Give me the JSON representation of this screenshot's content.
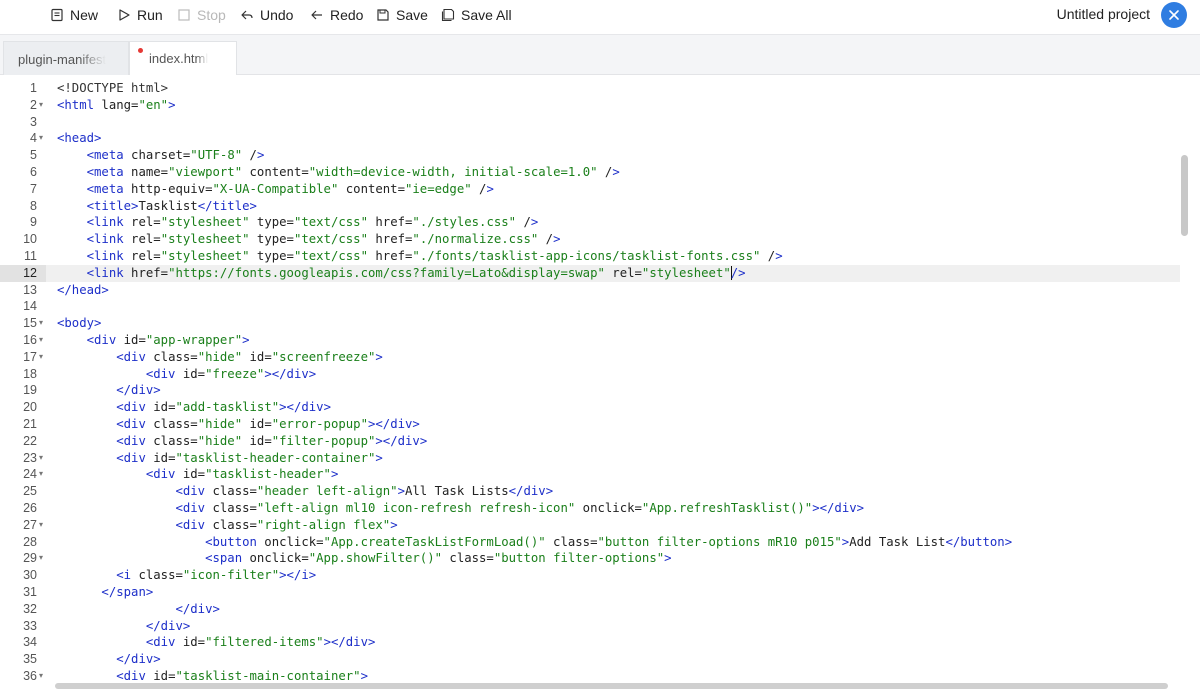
{
  "toolbar": {
    "new_label": "New",
    "run_label": "Run",
    "stop_label": "Stop",
    "undo_label": "Undo",
    "redo_label": "Redo",
    "save_label": "Save",
    "save_all_label": "Save All",
    "project_title": "Untitled project"
  },
  "tabs": [
    {
      "label": "plugin-manifest",
      "active": false,
      "modified": false
    },
    {
      "label": "index.html",
      "active": true,
      "modified": true
    }
  ],
  "editor": {
    "current_line": 12,
    "lines": [
      {
        "n": "1",
        "fold": false,
        "text": "<!DOCTYPE html>"
      },
      {
        "n": "2",
        "fold": true,
        "text": "<html lang=\"en\">"
      },
      {
        "n": "3",
        "fold": false,
        "text": ""
      },
      {
        "n": "4",
        "fold": true,
        "text": "<head>"
      },
      {
        "n": "5",
        "fold": false,
        "text": "    <meta charset=\"UTF-8\" />"
      },
      {
        "n": "6",
        "fold": false,
        "text": "    <meta name=\"viewport\" content=\"width=device-width, initial-scale=1.0\" />"
      },
      {
        "n": "7",
        "fold": false,
        "text": "    <meta http-equiv=\"X-UA-Compatible\" content=\"ie=edge\" />"
      },
      {
        "n": "8",
        "fold": false,
        "text": "    <title>Tasklist</title>"
      },
      {
        "n": "9",
        "fold": false,
        "text": "    <link rel=\"stylesheet\" type=\"text/css\" href=\"./styles.css\" />"
      },
      {
        "n": "10",
        "fold": false,
        "text": "    <link rel=\"stylesheet\" type=\"text/css\" href=\"./normalize.css\" />"
      },
      {
        "n": "11",
        "fold": false,
        "text": "    <link rel=\"stylesheet\" type=\"text/css\" href=\"./fonts/tasklist-app-icons/tasklist-fonts.css\" />"
      },
      {
        "n": "12",
        "fold": false,
        "text": "    <link href=\"https://fonts.googleapis.com/css?family=Lato&display=swap\" rel=\"stylesheet\"/>"
      },
      {
        "n": "13",
        "fold": false,
        "text": "</head>"
      },
      {
        "n": "14",
        "fold": false,
        "text": ""
      },
      {
        "n": "15",
        "fold": true,
        "text": "<body>"
      },
      {
        "n": "16",
        "fold": true,
        "text": "    <div id=\"app-wrapper\">"
      },
      {
        "n": "17",
        "fold": true,
        "text": "        <div class=\"hide\" id=\"screenfreeze\">"
      },
      {
        "n": "18",
        "fold": false,
        "text": "            <div id=\"freeze\"></div>"
      },
      {
        "n": "19",
        "fold": false,
        "text": "        </div>"
      },
      {
        "n": "20",
        "fold": false,
        "text": "        <div id=\"add-tasklist\"></div>"
      },
      {
        "n": "21",
        "fold": false,
        "text": "        <div class=\"hide\" id=\"error-popup\"></div>"
      },
      {
        "n": "22",
        "fold": false,
        "text": "        <div class=\"hide\" id=\"filter-popup\"></div>"
      },
      {
        "n": "23",
        "fold": true,
        "text": "        <div id=\"tasklist-header-container\">"
      },
      {
        "n": "24",
        "fold": true,
        "text": "            <div id=\"tasklist-header\">"
      },
      {
        "n": "25",
        "fold": false,
        "text": "                <div class=\"header left-align\">All Task Lists</div>"
      },
      {
        "n": "26",
        "fold": false,
        "text": "                <div class=\"left-align ml10 icon-refresh refresh-icon\" onclick=\"App.refreshTasklist()\"></div>"
      },
      {
        "n": "27",
        "fold": true,
        "text": "                <div class=\"right-align flex\">"
      },
      {
        "n": "28",
        "fold": false,
        "text": "                    <button onclick=\"App.createTaskListFormLoad()\" class=\"button filter-options mR10 p015\">Add Task List</button>"
      },
      {
        "n": "29",
        "fold": true,
        "text": "                    <span onclick=\"App.showFilter()\" class=\"button filter-options\">"
      },
      {
        "n": "30",
        "fold": false,
        "text": "        <i class=\"icon-filter\"></i>"
      },
      {
        "n": "31",
        "fold": false,
        "text": "      </span>"
      },
      {
        "n": "32",
        "fold": false,
        "text": "                </div>"
      },
      {
        "n": "33",
        "fold": false,
        "text": "            </div>"
      },
      {
        "n": "34",
        "fold": false,
        "text": "            <div id=\"filtered-items\"></div>"
      },
      {
        "n": "35",
        "fold": false,
        "text": "        </div>"
      },
      {
        "n": "36",
        "fold": true,
        "text": "        <div id=\"tasklist-main-container\">"
      }
    ]
  }
}
